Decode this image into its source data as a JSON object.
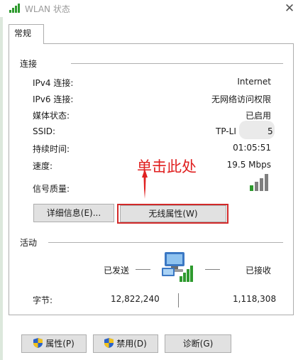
{
  "window": {
    "title": "WLAN 状态"
  },
  "tabs": [
    {
      "label": "常规"
    }
  ],
  "connection": {
    "title": "连接",
    "rows": [
      {
        "label": "IPv4 连接:",
        "value": "Internet"
      },
      {
        "label": "IPv6 连接:",
        "value": "无网络访问权限"
      },
      {
        "label": "媒体状态:",
        "value": "已启用"
      },
      {
        "label": "SSID:",
        "value": "TP-LI"
      },
      {
        "label": "持续时间:",
        "value": "01:05:51"
      },
      {
        "label": "速度:",
        "value": "19.5 Mbps"
      },
      {
        "label": "信号质量:",
        "value": ""
      }
    ],
    "ssid_suffix": "5",
    "signal_bars_filled": 1,
    "signal_bars_total": 4
  },
  "buttons": {
    "details": "详细信息(E)...",
    "wireless_props": "无线属性(W)"
  },
  "annotation": {
    "text": "单击此处",
    "color": "#e02020"
  },
  "activity": {
    "title": "活动",
    "sent_label": "已发送",
    "received_label": "已接收",
    "bytes_label": "字节:",
    "bytes_sent": "12,822,240",
    "bytes_received": "1,118,308"
  },
  "bottom_buttons": {
    "properties": "属性(P)",
    "disable": "禁用(D)",
    "diagnose": "诊断(G)"
  },
  "colors": {
    "highlight": "#d22a2a",
    "signal_green": "#2e9a2e",
    "shield_blue": "#2a62c8",
    "shield_yellow": "#f2c21b"
  },
  "icons": [
    "wifi-signal-icon",
    "close-icon",
    "network-computers-icon",
    "shield-icon"
  ]
}
